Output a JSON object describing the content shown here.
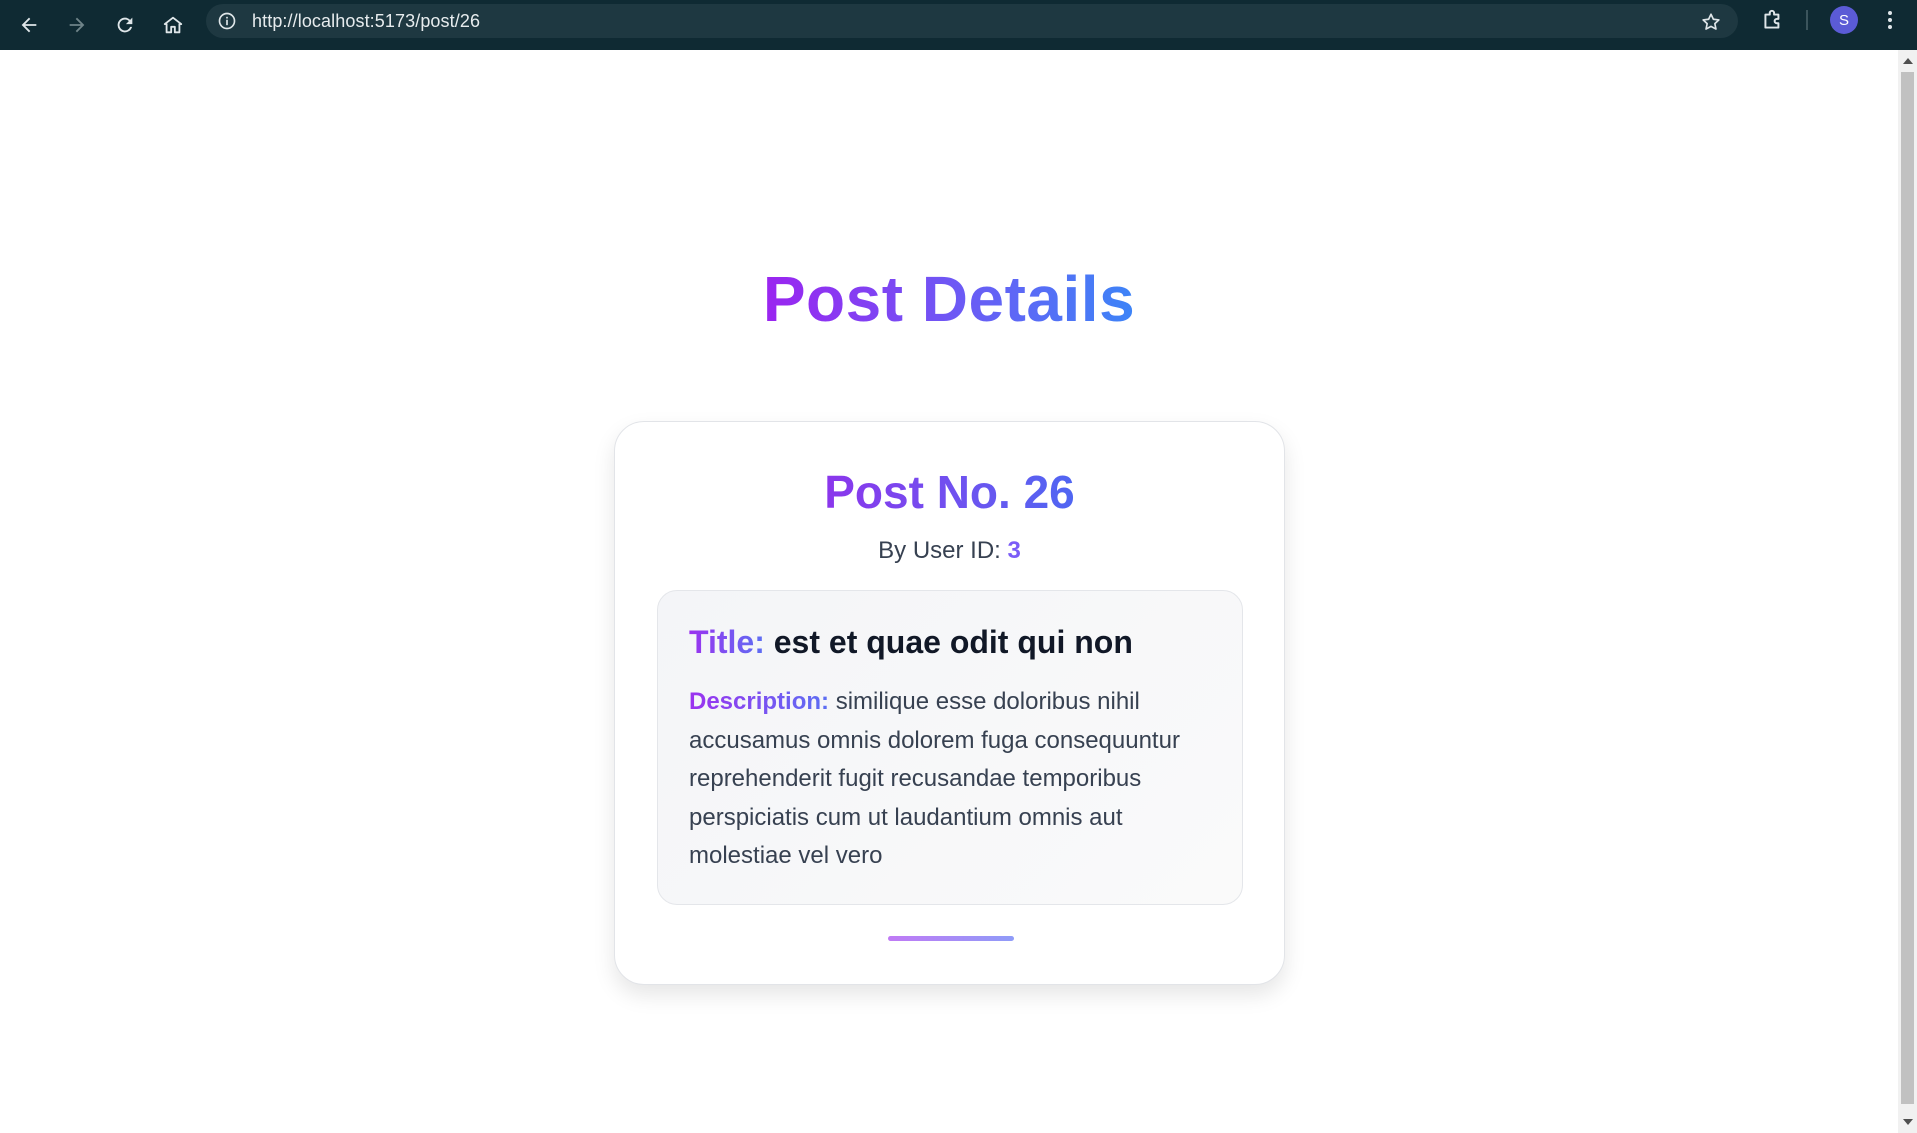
{
  "browser": {
    "url": "http://localhost:5173/post/26",
    "avatar_initial": "S",
    "icons": [
      "back-arrow-icon",
      "forward-arrow-icon",
      "reload-icon",
      "home-icon",
      "site-info-icon",
      "bookmark-star-icon",
      "extensions-puzzle-icon",
      "kebab-menu-icon"
    ]
  },
  "page": {
    "heading": "Post Details",
    "post": {
      "number_label": "Post No. 26",
      "by_user_prefix": "By User ID:",
      "user_id": "3",
      "title_label": "Title:",
      "title": "est et quae odit qui non",
      "description_label": "Description:",
      "description": "similique esse doloribus nihil accusamus omnis dolorem fuga consequuntur reprehenderit fugit recusandae temporibus perspiciatis cum ut laudantium omnis aut molestiae vel vero"
    }
  },
  "colors": {
    "chrome_bg": "#0f2a33",
    "omnibox_bg": "#1e3841",
    "gradient_start": "#9b24f0",
    "gradient_end": "#3d84f7",
    "user_id_color": "#7b5cf7"
  }
}
